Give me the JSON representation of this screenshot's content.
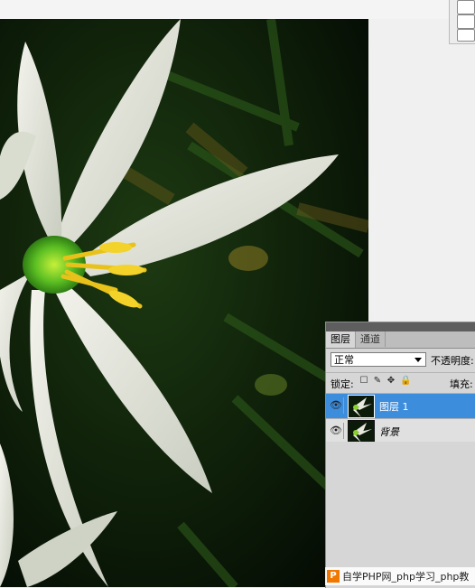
{
  "layers_panel": {
    "tabs": [
      {
        "label": "图层",
        "active": true
      },
      {
        "label": "通道",
        "active": false
      }
    ],
    "blend_mode": "正常",
    "opacity_label": "不透明度:",
    "lock_label": "锁定:",
    "lock_icons": [
      "lock-transparent-pixels-icon",
      "lock-image-pixels-icon",
      "lock-position-icon",
      "lock-all-icon"
    ],
    "fill_label": "填充:",
    "layers": [
      {
        "name": "图层 1",
        "selected": true,
        "visible": true
      },
      {
        "name": "背景",
        "selected": false,
        "visible": true
      }
    ]
  },
  "watermark": {
    "logo": "P",
    "text": "自学PHP网_php学习_php教"
  },
  "colors": {
    "selection": "#3d8ddd",
    "panel_bg": "#d6d6d6",
    "watermark_logo": "#f07800"
  }
}
